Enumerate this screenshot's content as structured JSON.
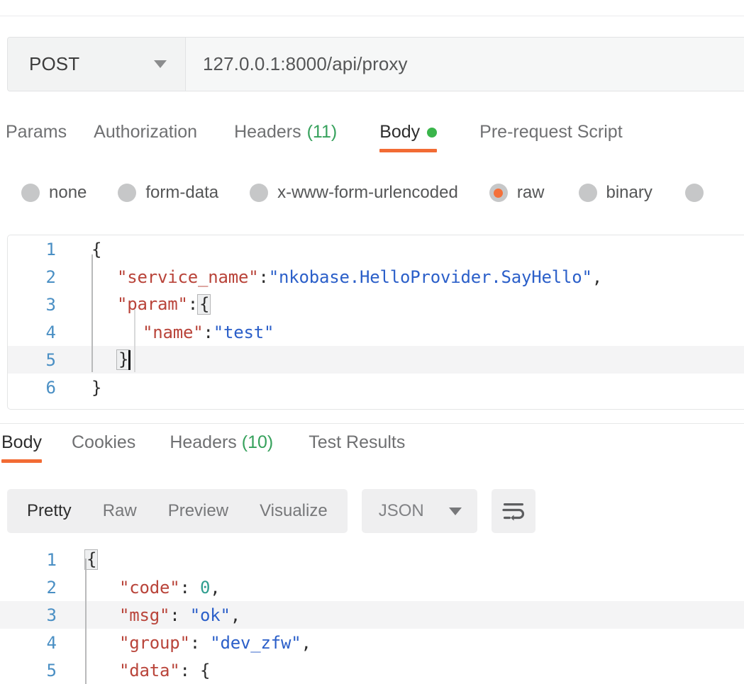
{
  "request": {
    "method": "POST",
    "url": "127.0.0.1:8000/api/proxy",
    "tabs": [
      {
        "label": "Params",
        "active": false
      },
      {
        "label": "Authorization",
        "active": false
      },
      {
        "label": "Headers",
        "count": "(11)",
        "active": false
      },
      {
        "label": "Body",
        "active": true,
        "dot": true
      },
      {
        "label": "Pre-request Script",
        "active": false
      }
    ],
    "body_types": [
      {
        "label": "none",
        "selected": false
      },
      {
        "label": "form-data",
        "selected": false
      },
      {
        "label": "x-www-form-urlencoded",
        "selected": false
      },
      {
        "label": "raw",
        "selected": true
      },
      {
        "label": "binary",
        "selected": false
      },
      {
        "label": "",
        "selected": false
      }
    ],
    "body_lines": [
      {
        "n": "1",
        "indent": 0,
        "tokens": [
          {
            "t": "{",
            "c": "punct"
          }
        ]
      },
      {
        "n": "2",
        "indent": 1,
        "tokens": [
          {
            "t": "\"service_name\"",
            "c": "key"
          },
          {
            "t": ":",
            "c": "punct"
          },
          {
            "t": "\"nkobase.HelloProvider.SayHello\"",
            "c": "str"
          },
          {
            "t": ",",
            "c": "punct"
          }
        ]
      },
      {
        "n": "3",
        "indent": 1,
        "tokens": [
          {
            "t": "\"param\"",
            "c": "key"
          },
          {
            "t": ":",
            "c": "punct"
          },
          {
            "t": "{",
            "c": "brace"
          }
        ]
      },
      {
        "n": "4",
        "indent": 2,
        "tokens": [
          {
            "t": "\"name\"",
            "c": "key"
          },
          {
            "t": ":",
            "c": "punct"
          },
          {
            "t": "\"test\"",
            "c": "str"
          }
        ]
      },
      {
        "n": "5",
        "indent": 1,
        "highlight": true,
        "caret": true,
        "tokens": [
          {
            "t": "}",
            "c": "brace"
          }
        ]
      },
      {
        "n": "6",
        "indent": 0,
        "tokens": [
          {
            "t": "}",
            "c": "punct"
          }
        ]
      }
    ]
  },
  "response": {
    "tabs": [
      {
        "label": "Body",
        "active": true
      },
      {
        "label": "Cookies",
        "active": false
      },
      {
        "label": "Headers",
        "count": "(10)",
        "active": false
      },
      {
        "label": "Test Results",
        "active": false
      }
    ],
    "view_modes": [
      {
        "label": "Pretty",
        "active": true
      },
      {
        "label": "Raw",
        "active": false
      },
      {
        "label": "Preview",
        "active": false
      },
      {
        "label": "Visualize",
        "active": false
      }
    ],
    "format": "JSON",
    "wrap_icon": "word-wrap-icon",
    "body_lines": [
      {
        "n": "1",
        "indent": 0,
        "tokens": [
          {
            "t": "{",
            "c": "brace"
          }
        ]
      },
      {
        "n": "2",
        "indent": 1,
        "tokens": [
          {
            "t": "\"code\"",
            "c": "key"
          },
          {
            "t": ": ",
            "c": "punct"
          },
          {
            "t": "0",
            "c": "num"
          },
          {
            "t": ",",
            "c": "punct"
          }
        ]
      },
      {
        "n": "3",
        "indent": 1,
        "highlight": true,
        "tokens": [
          {
            "t": "\"msg\"",
            "c": "key"
          },
          {
            "t": ": ",
            "c": "punct"
          },
          {
            "t": "\"ok\"",
            "c": "str"
          },
          {
            "t": ",",
            "c": "punct"
          }
        ]
      },
      {
        "n": "4",
        "indent": 1,
        "tokens": [
          {
            "t": "\"group\"",
            "c": "key"
          },
          {
            "t": ": ",
            "c": "punct"
          },
          {
            "t": "\"dev_zfw\"",
            "c": "str"
          },
          {
            "t": ",",
            "c": "punct"
          }
        ]
      },
      {
        "n": "5",
        "indent": 1,
        "tokens": [
          {
            "t": "\"data\"",
            "c": "key"
          },
          {
            "t": ": ",
            "c": "punct"
          },
          {
            "t": "{",
            "c": "punct"
          }
        ]
      }
    ]
  },
  "colors": {
    "accent_orange": "#f26b34",
    "green_dot": "#3ab54b",
    "count_green": "#36a15c",
    "json_key": "#b9443a",
    "json_string": "#2b5fc9",
    "json_number": "#2f9e8f",
    "gutter_blue": "#4a8fc4"
  }
}
